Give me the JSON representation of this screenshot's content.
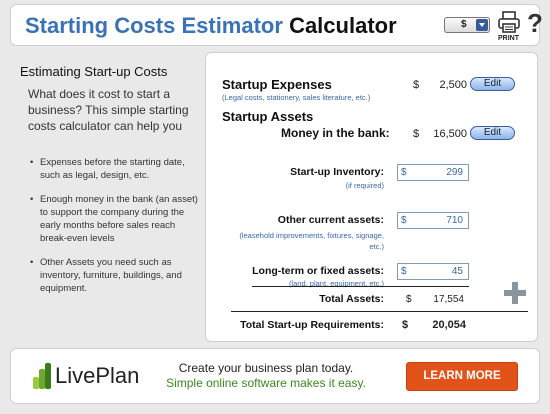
{
  "header": {
    "title_part1": "Starting Costs Estimator",
    "title_part2": "Calculator",
    "currency_value": "$",
    "print_label": "PRINT",
    "help_label": "?"
  },
  "left_panel": {
    "title": "Estimating Start-up Costs",
    "intro": "What does it cost to start a business? This simple starting costs calculator can help you",
    "bullets": [
      "Expenses before the starting date, such as legal, design, etc.",
      "Enough money in the bank (an asset) to support the company during the early months before sales reach break-even levels",
      "Other Assets you need such as inventory, furniture, buildings, and equipment."
    ]
  },
  "calculator": {
    "startup_expenses": {
      "label": "Startup Expenses",
      "sublabel": "(Legal costs, stationery, sales literature, etc.)",
      "currency": "$",
      "value": "2,500",
      "edit_label": "Edit"
    },
    "startup_assets_label": "Startup Assets",
    "money_in_bank": {
      "label": "Money in the bank:",
      "currency": "$",
      "value": "16,500",
      "edit_label": "Edit"
    },
    "inventory": {
      "label": "Start-up Inventory:",
      "sublabel": "(if required)",
      "currency": "$",
      "value": "299"
    },
    "other_current_assets": {
      "label": "Other current assets:",
      "sublabel": "(leasehold improvements, fixtures, signage, etc.)",
      "currency": "$",
      "value": "710"
    },
    "long_term_assets": {
      "label": "Long-term or fixed assets:",
      "sublabel": "(land, plant, equipment, etc.)",
      "currency": "$",
      "value": "45"
    },
    "total_assets": {
      "label": "Total Assets:",
      "currency": "$",
      "value": "17,554"
    },
    "total_requirements": {
      "label": "Total Start-up Requirements:",
      "currency": "$",
      "value": "20,054"
    }
  },
  "footer": {
    "logo_text": "LivePlan",
    "tagline1": "Create your business plan today.",
    "tagline2": "Simple online software makes it easy.",
    "cta_label": "LEARN MORE"
  }
}
